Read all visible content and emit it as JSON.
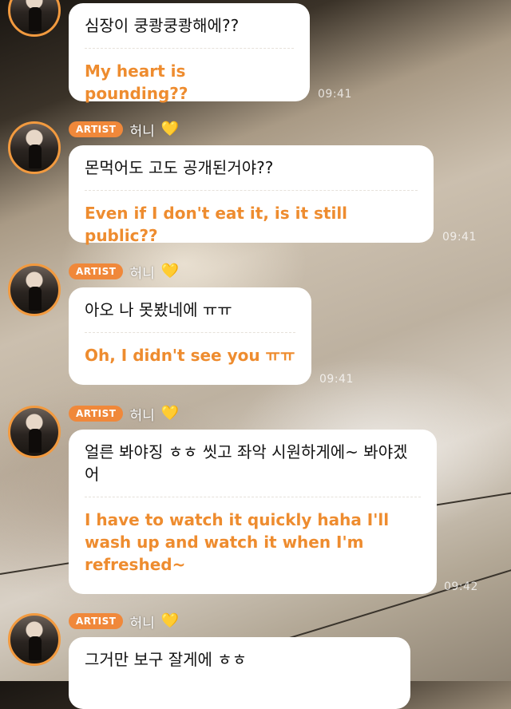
{
  "colors": {
    "accent": "#f0883a",
    "translation": "#ee8c2f",
    "bubble": "#ffffff",
    "heart": "#f4c430"
  },
  "messages": [
    {
      "badge": "",
      "name": "",
      "heart": "",
      "korean": "심장이 쿵쾅쿵쾅해에??",
      "english": "My heart is pounding??",
      "time": "09:41"
    },
    {
      "badge": "ARTIST",
      "name": "허니",
      "heart": "💛",
      "korean": "몬먹어도 고도 공개된거야??",
      "english": "Even if I don't eat it, is it still public??",
      "time": "09:41"
    },
    {
      "badge": "ARTIST",
      "name": "허니",
      "heart": "💛",
      "korean": "아오 나 못봤네에 ㅠㅠ",
      "english": "Oh, I didn't see you ㅠㅠ",
      "time": "09:41"
    },
    {
      "badge": "ARTIST",
      "name": "허니",
      "heart": "💛",
      "korean": "얼른 봐야징 ㅎㅎ 씻고 좌악 시원하게에~ 봐야겠어",
      "english": "I have to watch it quickly haha I'll wash up and watch it when I'm refreshed~",
      "time": "09:42"
    },
    {
      "badge": "ARTIST",
      "name": "허니",
      "heart": "💛",
      "korean": "그거만 보구 잘게에 ㅎㅎ",
      "english": "",
      "time": ""
    }
  ]
}
